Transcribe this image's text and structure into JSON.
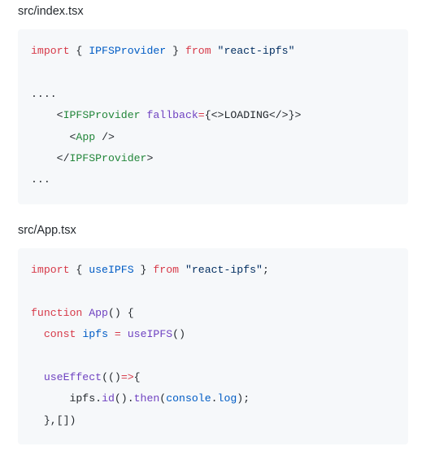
{
  "files": [
    {
      "path": "src/index.tsx",
      "lines": [
        {
          "segments": [
            {
              "cls": "tok-keyword",
              "t": "import"
            },
            {
              "cls": "tok-plain",
              "t": " { "
            },
            {
              "cls": "tok-var",
              "t": "IPFSProvider"
            },
            {
              "cls": "tok-plain",
              "t": " } "
            },
            {
              "cls": "tok-keyword",
              "t": "from"
            },
            {
              "cls": "tok-plain",
              "t": " "
            },
            {
              "cls": "tok-string",
              "t": "\"react-ipfs\""
            }
          ]
        },
        {
          "segments": [
            {
              "cls": "tok-plain",
              "t": " "
            }
          ]
        },
        {
          "segments": [
            {
              "cls": "tok-plain",
              "t": "...."
            }
          ]
        },
        {
          "segments": [
            {
              "cls": "tok-plain",
              "t": "    "
            },
            {
              "cls": "tok-plain",
              "t": "<"
            },
            {
              "cls": "tok-tag",
              "t": "IPFSProvider"
            },
            {
              "cls": "tok-plain",
              "t": " "
            },
            {
              "cls": "tok-attr",
              "t": "fallback"
            },
            {
              "cls": "tok-keyword",
              "t": "="
            },
            {
              "cls": "tok-plain",
              "t": "{"
            },
            {
              "cls": "tok-plain",
              "t": "<>"
            },
            {
              "cls": "tok-plain",
              "t": "LOADING"
            },
            {
              "cls": "tok-plain",
              "t": "</>"
            },
            {
              "cls": "tok-plain",
              "t": "}"
            },
            {
              "cls": "tok-plain",
              "t": ">"
            }
          ]
        },
        {
          "segments": [
            {
              "cls": "tok-plain",
              "t": "      "
            },
            {
              "cls": "tok-plain",
              "t": "<"
            },
            {
              "cls": "tok-tag",
              "t": "App"
            },
            {
              "cls": "tok-plain",
              "t": " />"
            }
          ]
        },
        {
          "segments": [
            {
              "cls": "tok-plain",
              "t": "    "
            },
            {
              "cls": "tok-plain",
              "t": "</"
            },
            {
              "cls": "tok-tag",
              "t": "IPFSProvider"
            },
            {
              "cls": "tok-plain",
              "t": ">"
            }
          ]
        },
        {
          "segments": [
            {
              "cls": "tok-plain",
              "t": "..."
            }
          ]
        }
      ]
    },
    {
      "path": "src/App.tsx",
      "lines": [
        {
          "segments": [
            {
              "cls": "tok-keyword",
              "t": "import"
            },
            {
              "cls": "tok-plain",
              "t": " { "
            },
            {
              "cls": "tok-var",
              "t": "useIPFS"
            },
            {
              "cls": "tok-plain",
              "t": " } "
            },
            {
              "cls": "tok-keyword",
              "t": "from"
            },
            {
              "cls": "tok-plain",
              "t": " "
            },
            {
              "cls": "tok-string",
              "t": "\"react-ipfs\""
            },
            {
              "cls": "tok-plain",
              "t": ";"
            }
          ]
        },
        {
          "segments": [
            {
              "cls": "tok-plain",
              "t": " "
            }
          ]
        },
        {
          "segments": [
            {
              "cls": "tok-keyword",
              "t": "function"
            },
            {
              "cls": "tok-plain",
              "t": " "
            },
            {
              "cls": "tok-func",
              "t": "App"
            },
            {
              "cls": "tok-plain",
              "t": "() {"
            }
          ]
        },
        {
          "segments": [
            {
              "cls": "tok-plain",
              "t": "  "
            },
            {
              "cls": "tok-keyword",
              "t": "const"
            },
            {
              "cls": "tok-plain",
              "t": " "
            },
            {
              "cls": "tok-var",
              "t": "ipfs"
            },
            {
              "cls": "tok-plain",
              "t": " "
            },
            {
              "cls": "tok-keyword",
              "t": "="
            },
            {
              "cls": "tok-plain",
              "t": " "
            },
            {
              "cls": "tok-func",
              "t": "useIPFS"
            },
            {
              "cls": "tok-plain",
              "t": "()"
            }
          ]
        },
        {
          "segments": [
            {
              "cls": "tok-plain",
              "t": " "
            }
          ]
        },
        {
          "segments": [
            {
              "cls": "tok-plain",
              "t": "  "
            },
            {
              "cls": "tok-func",
              "t": "useEffect"
            },
            {
              "cls": "tok-plain",
              "t": "(()"
            },
            {
              "cls": "tok-keyword",
              "t": "=>"
            },
            {
              "cls": "tok-plain",
              "t": "{"
            }
          ]
        },
        {
          "segments": [
            {
              "cls": "tok-plain",
              "t": "      ipfs."
            },
            {
              "cls": "tok-func",
              "t": "id"
            },
            {
              "cls": "tok-plain",
              "t": "()."
            },
            {
              "cls": "tok-func",
              "t": "then"
            },
            {
              "cls": "tok-plain",
              "t": "("
            },
            {
              "cls": "tok-var",
              "t": "console"
            },
            {
              "cls": "tok-plain",
              "t": "."
            },
            {
              "cls": "tok-var",
              "t": "log"
            },
            {
              "cls": "tok-plain",
              "t": ");"
            }
          ]
        },
        {
          "segments": [
            {
              "cls": "tok-plain",
              "t": "  },[])"
            }
          ]
        }
      ]
    }
  ]
}
